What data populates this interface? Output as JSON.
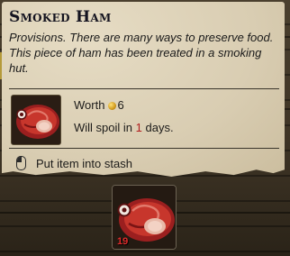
{
  "tooltip": {
    "title": "Smoked Ham",
    "description": "Provisions. There are many ways to preserve food. This piece of ham has been treated in a smoking hut.",
    "worth_label": "Worth",
    "worth_value": "6",
    "spoil_prefix": "Will spoil in",
    "spoil_days": "1",
    "spoil_suffix": "days.",
    "action_hint": "Put item into stash",
    "item_icon": "smoked-ham-icon",
    "coin_icon": "gold-coin-icon",
    "mouse_icon": "left-mouse-button-icon"
  },
  "inventory_slot": {
    "item_icon": "smoked-ham-icon",
    "count": "19"
  },
  "colors": {
    "parchment": "#d9cdb2",
    "title_text": "#14131f",
    "spoil_days": "#b11e1e",
    "slot_count": "#e02b2b"
  }
}
